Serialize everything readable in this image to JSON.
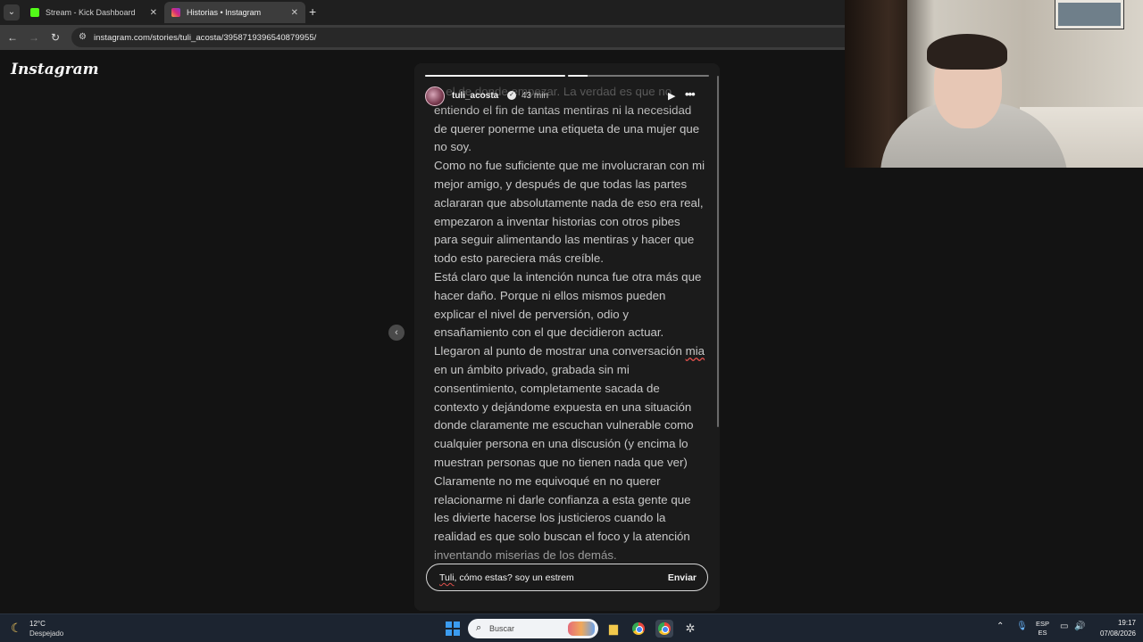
{
  "browser": {
    "tabs": [
      {
        "title": "Stream - Kick Dashboard",
        "favicon_color": "#53fc18",
        "active": false
      },
      {
        "title": "Historias • Instagram",
        "favicon_color": "#d6297a",
        "active": true
      }
    ],
    "url": "instagram.com/stories/tuli_acosta/3958719396540879955/"
  },
  "page": {
    "logo": "Instagram",
    "story": {
      "username": "tuli_acosta",
      "time_ago": "43 min",
      "progress": [
        1.0,
        0.14
      ],
      "paragraphs": [
        "…el de donde empezar. La verdad es que no entiendo el fin de tantas mentiras ni la necesidad de querer ponerme una etiqueta de una mujer que no soy.",
        "Como no fue suficiente que me involucraran con mi mejor amigo, y después de que todas las partes aclararan que absolutamente nada de eso era real, empezaron a inventar historias con otros pibes para seguir alimentando las mentiras y hacer que todo esto pareciera más creíble.",
        "Está claro que la intención nunca fue otra más que hacer daño. Porque ni ellos mismos pueden explicar el nivel de perversión, odio y ensañamiento con el que decidieron actuar.",
        "Llegaron al punto de mostrar una conversación",
        "mia",
        " en un ámbito privado, grabada sin mi consentimiento, completamente sacada de contexto y  dejándome expuesta  en una situación donde claramente me escuchan vulnerable como cualquier persona en una discusión (y encima lo muestran personas que no tienen  nada que ver)",
        "Claramente no me equivoqué en no querer relacionarme ni darle confianza a esta gente que les divierte hacerse los justicieros cuando la realidad es que solo buscan el foco y la atención inventando miserias de los demás."
      ],
      "reply": {
        "value_prefix": "Tuli",
        "value_rest": ", cómo estas? soy un estrem",
        "send_label": "Enviar"
      }
    }
  },
  "taskbar": {
    "weather_temp": "12°C",
    "weather_desc": "Despejado",
    "search_placeholder": "Buscar",
    "lang_top": "ESP",
    "lang_bottom": "ES",
    "time": "19:17",
    "date": "07/08/2026"
  }
}
